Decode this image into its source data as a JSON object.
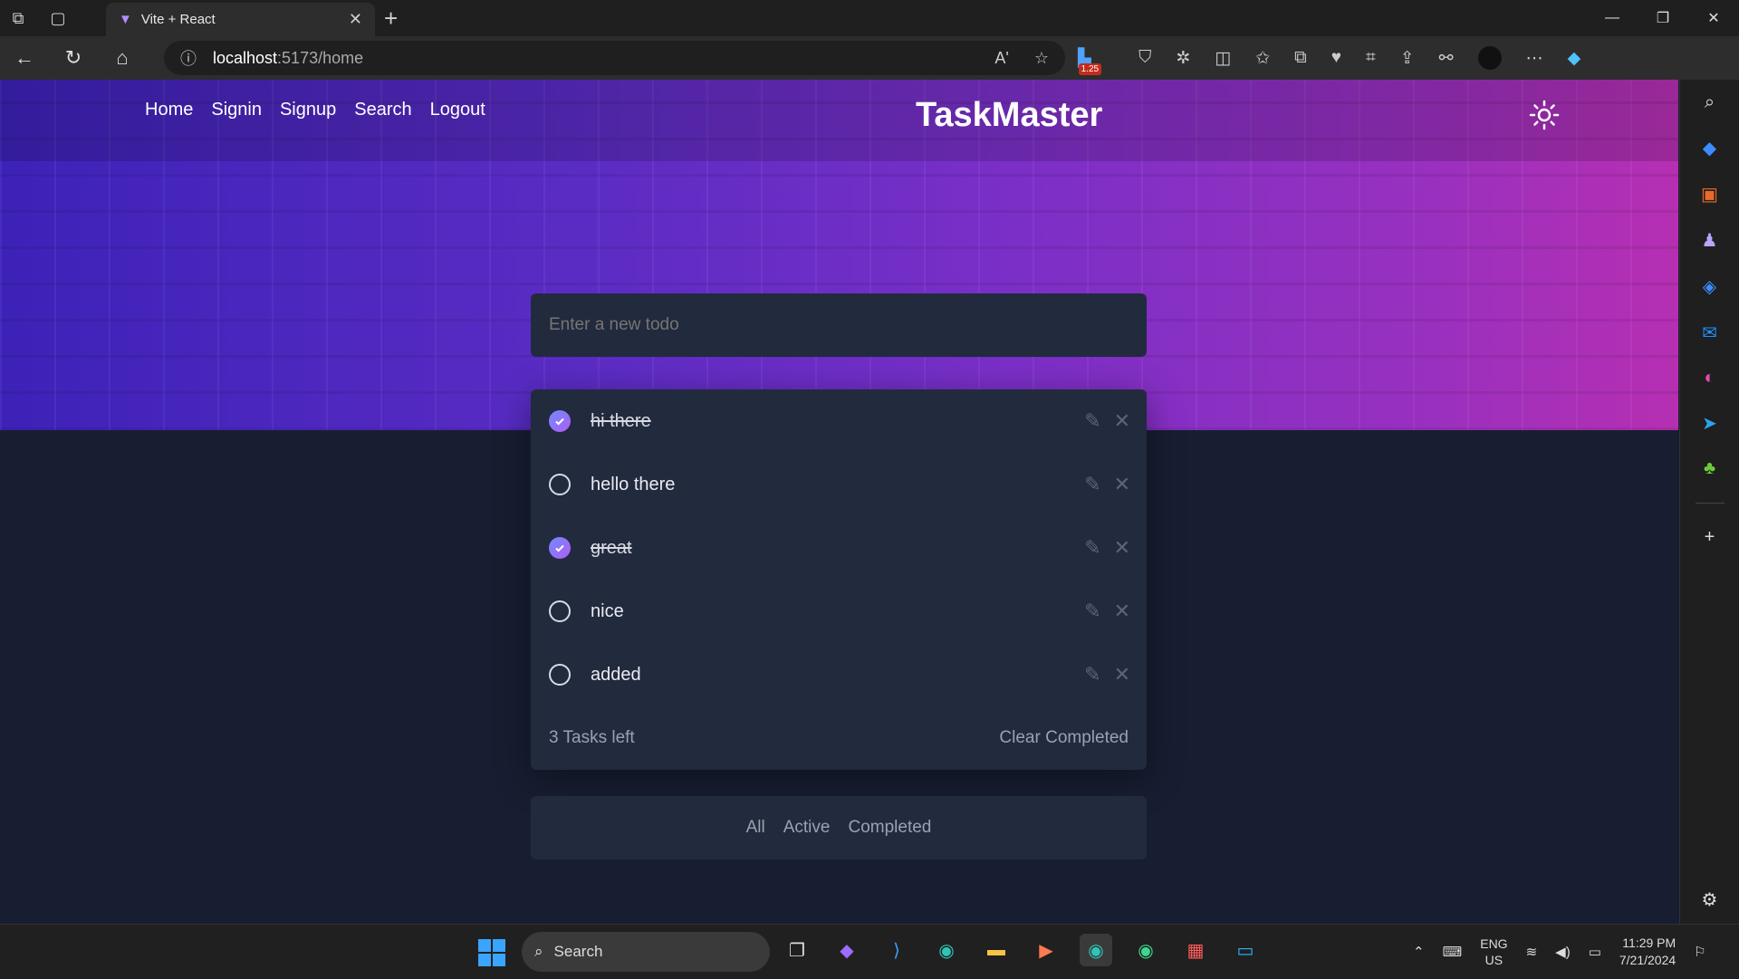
{
  "browser": {
    "tab_title": "Vite + React",
    "url_host": "localhost",
    "url_path": ":5173/home",
    "extension_badge": "1.25"
  },
  "app": {
    "nav": [
      "Home",
      "Signin",
      "Signup",
      "Search",
      "Logout"
    ],
    "brand": "TaskMaster",
    "input_placeholder": "Enter a new todo",
    "todos": [
      {
        "text": "hi there",
        "completed": true
      },
      {
        "text": "hello there",
        "completed": false
      },
      {
        "text": "great",
        "completed": true
      },
      {
        "text": "nice",
        "completed": false
      },
      {
        "text": "added",
        "completed": false
      }
    ],
    "tasks_left": "3 Tasks left",
    "clear_completed": "Clear Completed",
    "filters": [
      "All",
      "Active",
      "Completed"
    ]
  },
  "taskbar": {
    "search_placeholder": "Search",
    "lang_top": "ENG",
    "lang_bottom": "US",
    "time": "11:29 PM",
    "date": "7/21/2024"
  },
  "colors": {
    "accent": "#a65cf0",
    "card": "#222a3d",
    "page_bg": "#171e31"
  }
}
